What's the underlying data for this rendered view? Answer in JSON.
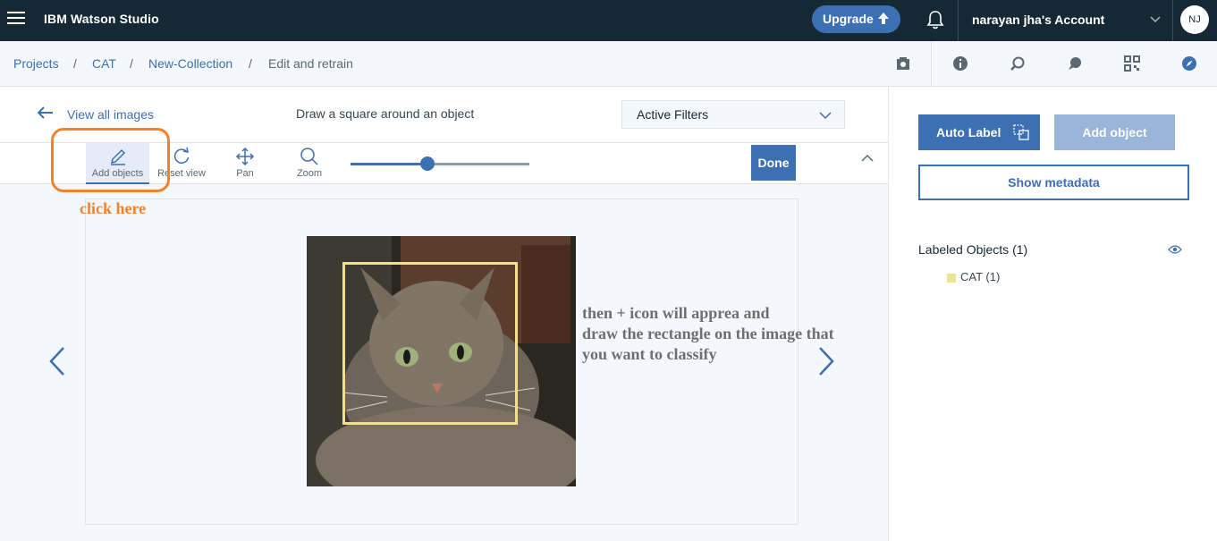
{
  "header": {
    "app_title": "IBM Watson Studio",
    "upgrade_label": "Upgrade",
    "account_label": "narayan jha's Account",
    "avatar_initials": "NJ"
  },
  "breadcrumb": {
    "items": [
      "Projects",
      "CAT",
      "New-Collection"
    ],
    "separator": "/",
    "current": "Edit and retrain"
  },
  "editor": {
    "back_label": "View all images",
    "instruction": "Draw a square around an object",
    "filter_label": "Active Filters",
    "tools": [
      {
        "name": "add-objects",
        "label": "Add objects",
        "icon": "pencil-icon"
      },
      {
        "name": "reset-view",
        "label": "Reset view",
        "icon": "reset-icon"
      },
      {
        "name": "pan",
        "label": "Pan",
        "icon": "pan-icon"
      },
      {
        "name": "zoom",
        "label": "Zoom",
        "icon": "zoom-icon"
      }
    ],
    "zoom_slider_fraction": 0.43,
    "done_label": "Done"
  },
  "annotations": {
    "click_here": "click here",
    "note_lines": [
      "then + icon will apprea and",
      "draw the rectangle on the image that",
      "you want to classify"
    ]
  },
  "sidebar": {
    "auto_label": "Auto Label",
    "add_object": "Add object",
    "show_metadata": "Show metadata",
    "labeled_objects_title": "Labeled Objects (1)",
    "labels": [
      {
        "name": "CAT (1)",
        "color": "#ede58e"
      }
    ]
  },
  "colors": {
    "header_bg": "#152935",
    "primary": "#3d70b2",
    "annotation_orange": "#f5822a",
    "label_box": "#f2e18a"
  }
}
